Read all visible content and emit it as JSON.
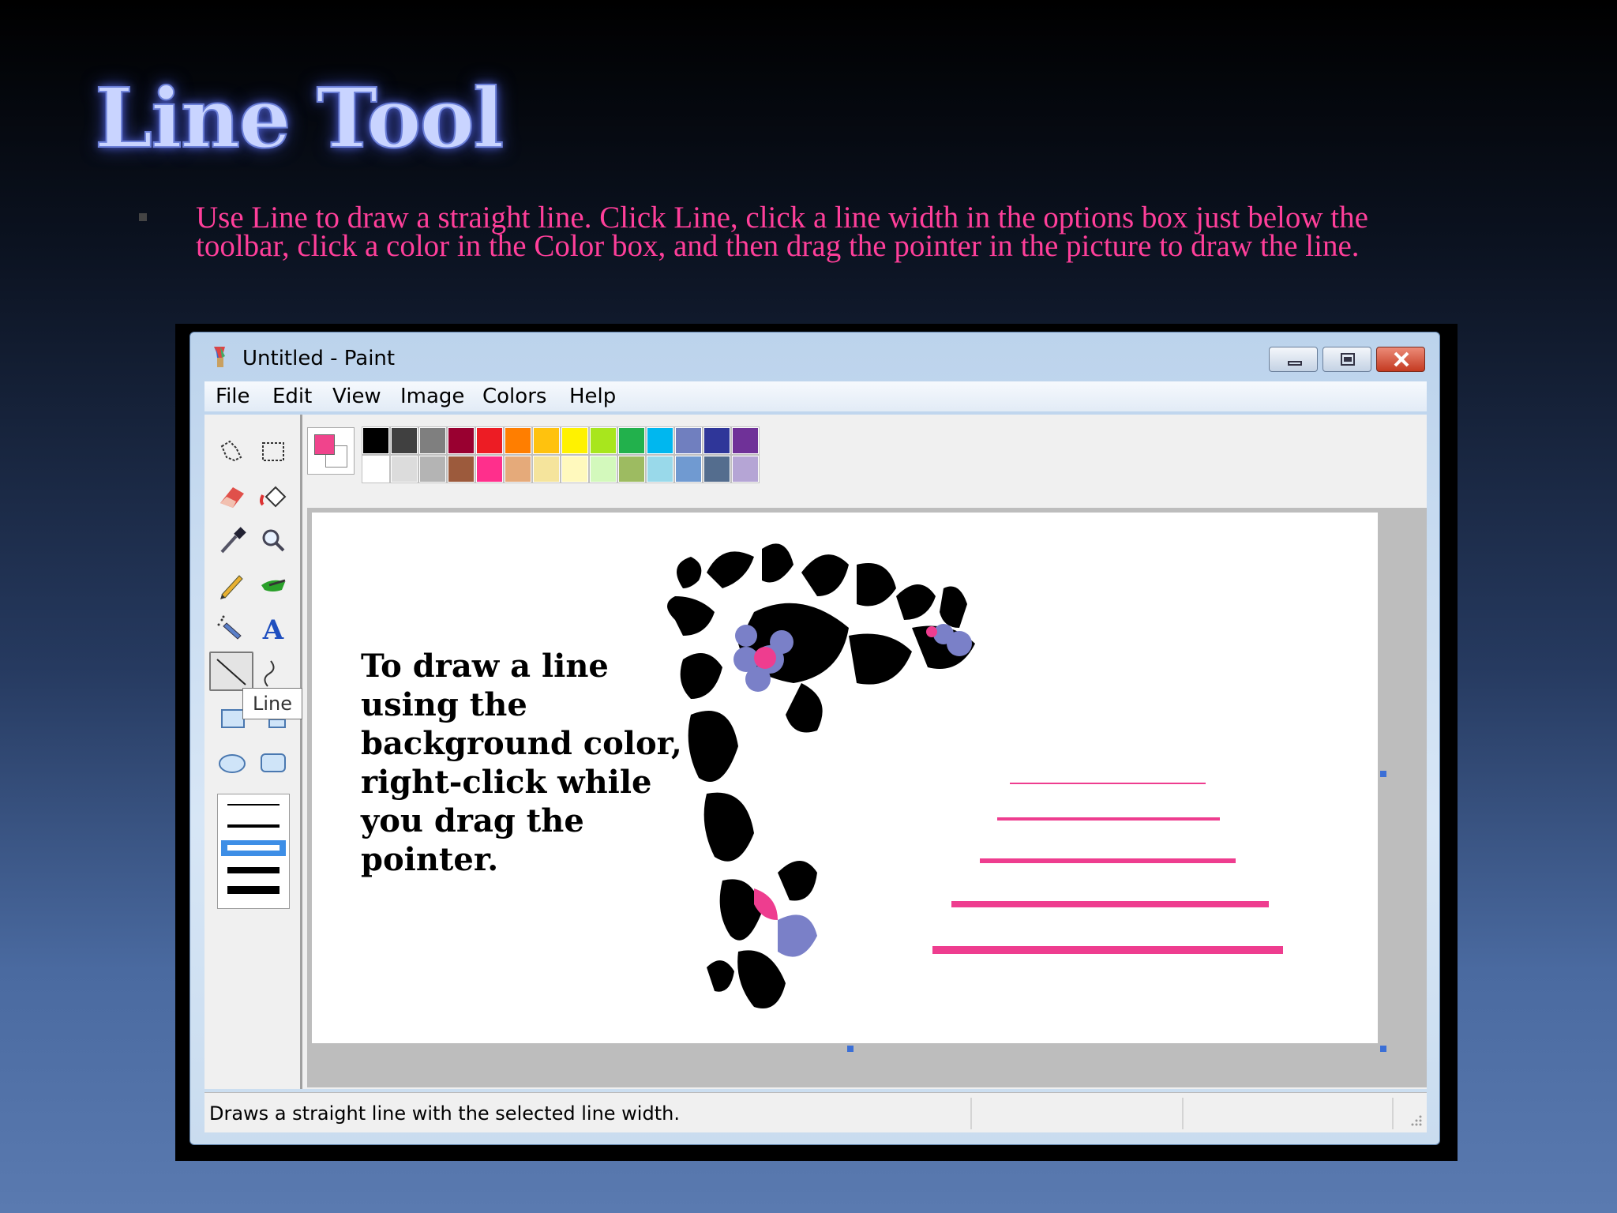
{
  "slide": {
    "title": "Line Tool",
    "body": "Use Line to draw a straight line. Click Line, click a line width in the options box just below the toolbar, click a color in the Color box, and then drag the pointer in the picture to draw the line."
  },
  "window": {
    "title": "Untitled - Paint",
    "app_icon": "paint-icon"
  },
  "menu": [
    "File",
    "Edit",
    "View",
    "Image",
    "Colors",
    "Help"
  ],
  "toolbox": {
    "tooltip": "Line",
    "tools": [
      "free-form-select-icon",
      "select-icon",
      "eraser-icon",
      "fill-with-color-icon",
      "pick-color-icon",
      "magnifier-icon",
      "pencil-icon",
      "brush-icon",
      "airbrush-icon",
      "text-icon",
      "line-icon",
      "curve-icon",
      "rectangle-icon",
      "polygon-icon",
      "ellipse-icon",
      "rounded-rectangle-icon"
    ],
    "line_widths": 5,
    "selected_width_index": 2
  },
  "palette": {
    "foreground": "#f0448c",
    "background": "#ffffff",
    "row1": [
      "#000000",
      "#404040",
      "#7f7f7f",
      "#990030",
      "#ed1c24",
      "#ff7e00",
      "#ffc20e",
      "#fff200",
      "#a8e61d",
      "#22b14c",
      "#00b7ef",
      "#707fbf",
      "#2f3699",
      "#6f3198"
    ],
    "row2": [
      "#ffffff",
      "#dcdcdc",
      "#b4b4b4",
      "#9c5a3c",
      "#ff2f8c",
      "#e5aa7a",
      "#f5e49c",
      "#fff9bd",
      "#d3f9bc",
      "#9dbb61",
      "#99d9ea",
      "#709ad1",
      "#546d8e",
      "#b5a5d5"
    ]
  },
  "canvas": {
    "text": "To draw a line using the background color, right-click while you drag the pointer.",
    "line_color": "#ee3d8f",
    "drawing": "floral-ornament"
  },
  "status": {
    "text": "Draws a straight line with the selected line width."
  }
}
